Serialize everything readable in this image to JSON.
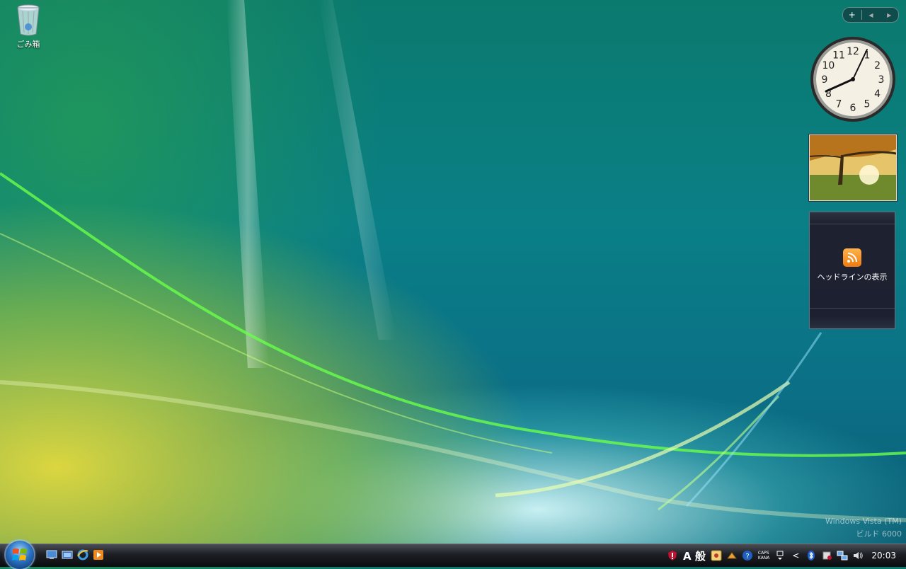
{
  "desktop": {
    "recycle_bin_label": "ごみ箱"
  },
  "sidebar": {
    "add_symbol": "+",
    "prev_symbol": "◀",
    "next_symbol": "▶",
    "clock_numbers": [
      "12",
      "1",
      "2",
      "3",
      "4",
      "5",
      "6",
      "7",
      "8",
      "9",
      "10",
      "11"
    ],
    "headlines_label": "ヘッドラインの表示"
  },
  "watermark": {
    "line1": "Windows Vista (TM)",
    "line2": "ビルド 6000"
  },
  "taskbar": {
    "ime_mode": "A 般",
    "caps_label": "CAPS",
    "kana_label": "KANA",
    "show_hidden_symbol": "<",
    "time": "20:03"
  }
}
